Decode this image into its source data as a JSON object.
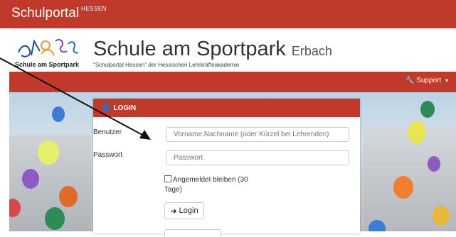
{
  "topbar": {
    "brand": "Schulportal",
    "brand_sup": "HESSEN"
  },
  "header": {
    "logo_text": "Schule am Sportpark",
    "school_name": "Schule am Sportpark",
    "school_city": "Erbach",
    "subtitle": "\"Schulportal Hessen\" der Hessischen Lehrkräfteakademie"
  },
  "navbar": {
    "support_label": "Support"
  },
  "login": {
    "title": "LOGIN",
    "username_label": "Benutzer",
    "username_placeholder": "Vorname.Nachname (oder Kürzel bei Lehrenden)",
    "password_label": "Passwort",
    "password_placeholder": "Passwort",
    "remember_label": "Angemeldet bleiben (30 Tage)",
    "login_button": "Login"
  },
  "colors": {
    "brand_red": "#c0392b"
  }
}
